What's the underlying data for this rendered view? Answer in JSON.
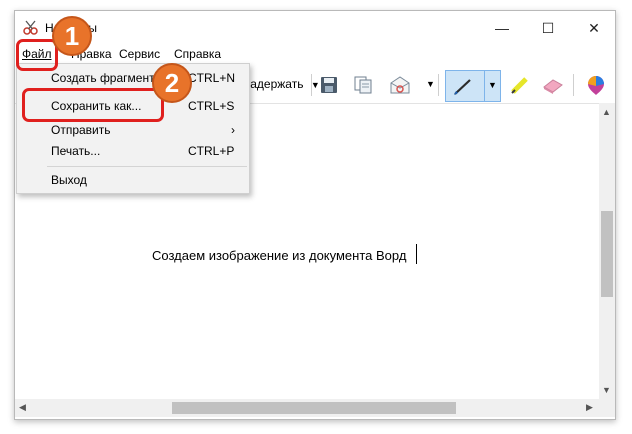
{
  "window": {
    "title": "Ножницы",
    "controls": {
      "minimize": "—",
      "maximize": "☐",
      "close": "✕"
    }
  },
  "menubar": {
    "file": "Файл",
    "edit": "Правка",
    "service": "Сервис",
    "help": "Справка"
  },
  "toolbar": {
    "delay_label": "Задержать"
  },
  "file_menu": {
    "items": [
      {
        "label": "Создать фрагмент",
        "shortcut": "CTRL+N"
      },
      {
        "label": "Сохранить как...",
        "shortcut": "CTRL+S"
      },
      {
        "label": "Отправить",
        "shortcut": "›"
      },
      {
        "label": "Печать...",
        "shortcut": "CTRL+P"
      },
      {
        "label": "Выход",
        "shortcut": ""
      }
    ]
  },
  "document": {
    "text": "Создаем изображение из документа Ворд"
  },
  "annotations": {
    "step1": "1",
    "step2": "2",
    "color": "#e8732a",
    "highlight_color": "#e0201e"
  }
}
